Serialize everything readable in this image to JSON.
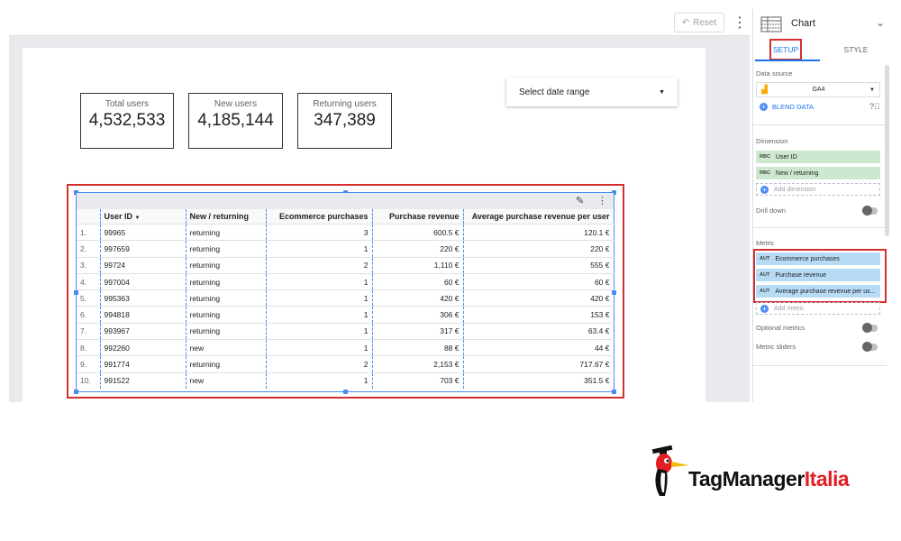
{
  "toolbar": {
    "reset_label": "Reset"
  },
  "scorecards": [
    {
      "label": "Total users",
      "value": "4,532,533"
    },
    {
      "label": "New users",
      "value": "4,185,144"
    },
    {
      "label": "Returning users",
      "value": "347,389"
    }
  ],
  "date_range": {
    "label": "Select date range"
  },
  "table": {
    "columns": [
      "User ID",
      "New / returning",
      "Ecommerce purchases",
      "Purchase revenue",
      "Average purchase revenue per user"
    ],
    "rows": [
      [
        "1.",
        "99965",
        "returning",
        "3",
        "600.5 €",
        "120.1 €"
      ],
      [
        "2.",
        "997659",
        "returning",
        "1",
        "220 €",
        "220 €"
      ],
      [
        "3.",
        "99724",
        "returning",
        "2",
        "1,110 €",
        "555 €"
      ],
      [
        "4.",
        "997004",
        "returning",
        "1",
        "60 €",
        "60 €"
      ],
      [
        "5.",
        "995363",
        "returning",
        "1",
        "420 €",
        "420 €"
      ],
      [
        "6.",
        "994818",
        "returning",
        "1",
        "306 €",
        "153 €"
      ],
      [
        "7.",
        "993967",
        "returning",
        "1",
        "317 €",
        "63.4 €"
      ],
      [
        "8.",
        "992260",
        "new",
        "1",
        "88 €",
        "44 €"
      ],
      [
        "9.",
        "991774",
        "returning",
        "2",
        "2,153 €",
        "717.67 €"
      ],
      [
        "10.",
        "991522",
        "new",
        "1",
        "703 €",
        "351.5 €"
      ]
    ]
  },
  "panel": {
    "title": "Chart",
    "tabs": {
      "setup": "SETUP",
      "style": "STYLE"
    },
    "data_source_title": "Data source",
    "data_source_value": "GA4",
    "blend_label": "BLEND DATA",
    "dimension_title": "Dimension",
    "dimensions": [
      "User ID",
      "New / returning"
    ],
    "dim_tag": "RBC",
    "add_dimension": "Add dimension",
    "drill_down": "Drill down",
    "metric_title": "Metric",
    "metric_tag": "AUT",
    "metrics": [
      "Ecommerce purchases",
      "Purchase revenue",
      "Average purchase revenue per us..."
    ],
    "add_metric": "Add metric",
    "optional_metrics": "Optional metrics",
    "metric_sliders": "Metric sliders"
  },
  "logo": {
    "part1": "TagManager",
    "part2": "Italia"
  },
  "colors": {
    "accent_blue": "#1a73e8",
    "highlight_red": "#d32f2f",
    "logo_red": "#e31e24"
  }
}
